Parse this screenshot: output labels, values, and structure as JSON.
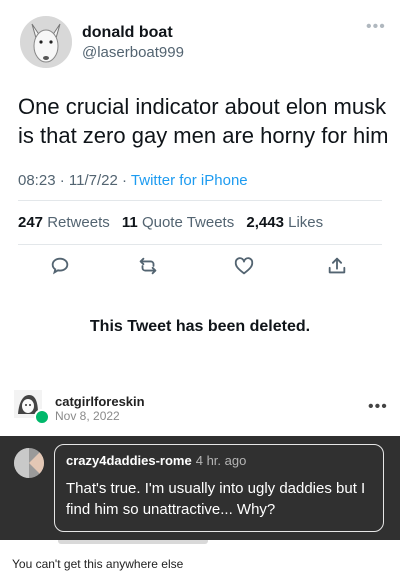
{
  "tweet": {
    "display_name": "donald boat",
    "handle": "@laserboat999",
    "more_icon": "more-dots-icon",
    "text": "One crucial indicator about elon musk is that zero gay men are horny for him",
    "time": "08:23",
    "date": "11/7/22",
    "separator": "·",
    "source": "Twitter for iPhone",
    "stats": {
      "retweets_count": "247",
      "retweets_label": "Retweets",
      "quote_count": "11",
      "quote_label": "Quote Tweets",
      "likes_count": "2,443",
      "likes_label": "Likes"
    },
    "actions": [
      "reply-icon",
      "retweet-icon",
      "like-icon",
      "share-icon"
    ],
    "deleted_notice": "This Tweet has been deleted."
  },
  "reblog": {
    "username": "catgirlforeskin",
    "date": "Nov 8, 2022",
    "badge_color": "#00b86b"
  },
  "comment": {
    "username": "crazy4daddies-rome",
    "time": "4 hr. ago",
    "text": "That's true. I'm usually into ugly daddies but I find him so unattractive... Why?",
    "panel_color": "#303030"
  },
  "caption": "You can't get this anywhere else",
  "colors": {
    "link_blue": "#1d9bf0",
    "secondary_text": "#536471",
    "primary_text": "#0f1419"
  }
}
